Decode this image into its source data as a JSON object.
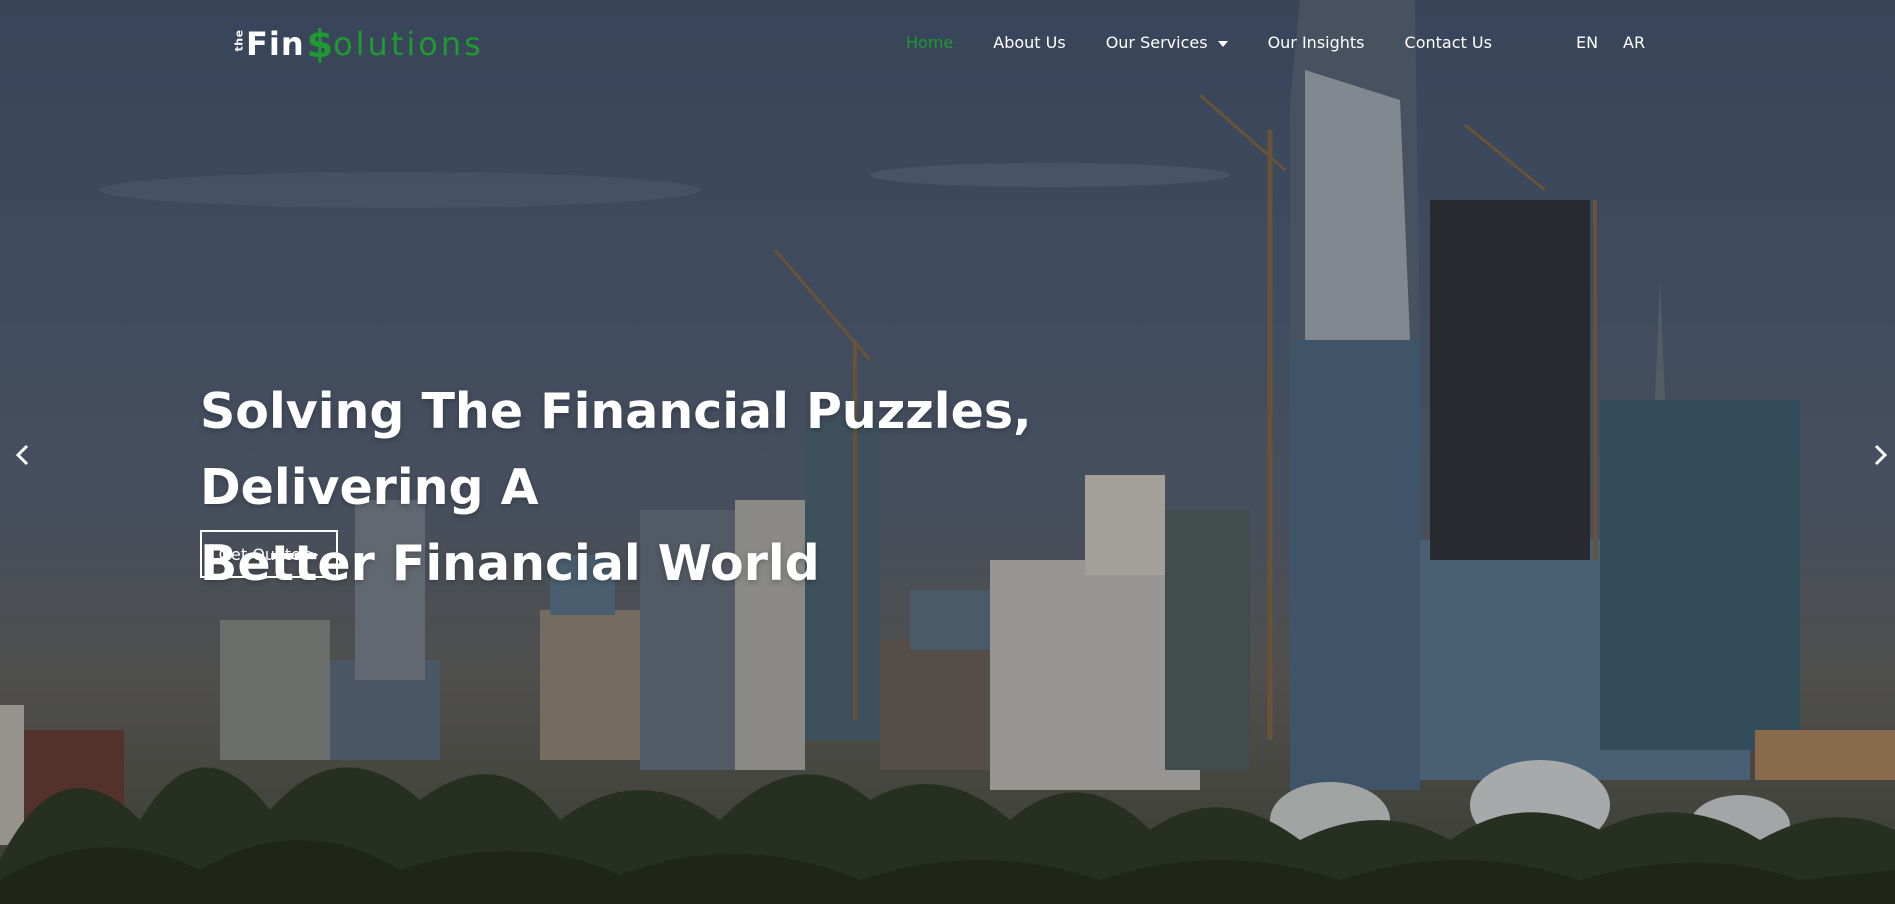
{
  "brand": {
    "logo_the": "the",
    "logo_fin": "Fin",
    "logo_dollar": "$",
    "logo_rest": "olutions",
    "accent_color": "#1f9a32"
  },
  "nav": {
    "items": [
      {
        "label": "Home",
        "active": true
      },
      {
        "label": "About Us",
        "active": false
      },
      {
        "label": "Our Services",
        "active": false,
        "has_dropdown": true
      },
      {
        "label": "Our Insights",
        "active": false
      },
      {
        "label": "Contact Us",
        "active": false
      }
    ],
    "languages": [
      "EN",
      "AR"
    ]
  },
  "hero": {
    "headline_line1": "Solving The Financial Puzzles, Delivering A",
    "headline_line2": "Better Financial World",
    "cta_label": "Get Quote >",
    "background": "city skyline with construction cranes and palm trees",
    "prev_icon": "chevron-left-icon",
    "next_icon": "chevron-right-icon"
  }
}
